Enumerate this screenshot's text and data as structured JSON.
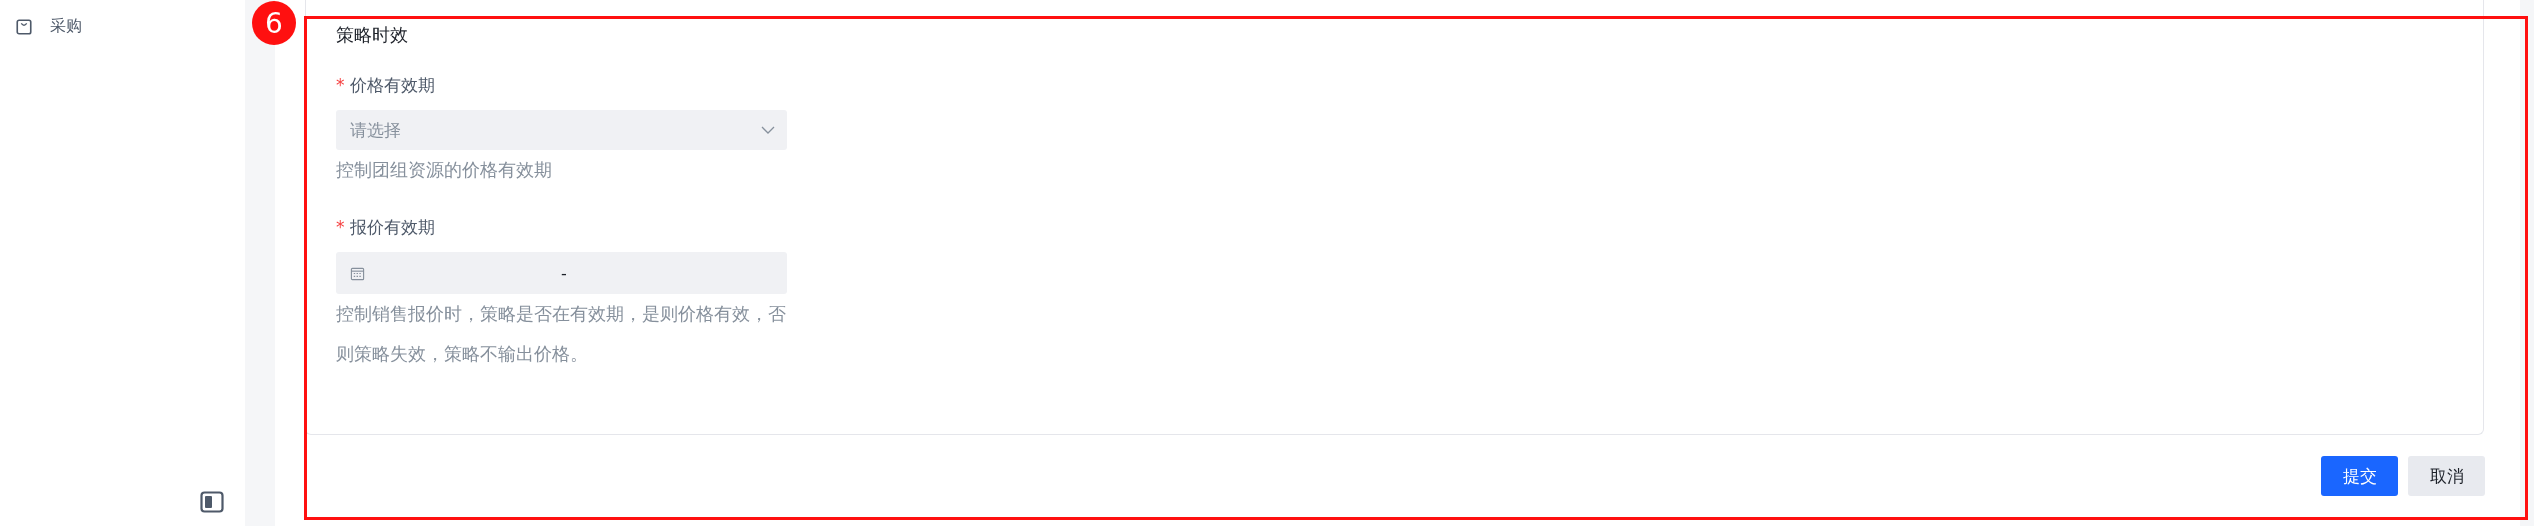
{
  "sidebar": {
    "items": [
      {
        "label": "采购",
        "selected": false
      }
    ]
  },
  "annotation": {
    "number": "6"
  },
  "section": {
    "title": "策略时效",
    "fields": [
      {
        "kind": "select",
        "label": "价格有效期",
        "required_mark": "*",
        "placeholder": "请选择",
        "hint": "控制团组资源的价格有效期"
      },
      {
        "kind": "daterange",
        "label": "报价有效期",
        "required_mark": "*",
        "separator": "-",
        "hint": "控制销售报价时，策略是否在有效期，是则价格有效，否则策略失效，策略不输出价格。"
      }
    ]
  },
  "buttons": [
    {
      "label": "提交",
      "kind": "primary"
    },
    {
      "label": "取消",
      "kind": "secondary"
    }
  ]
}
